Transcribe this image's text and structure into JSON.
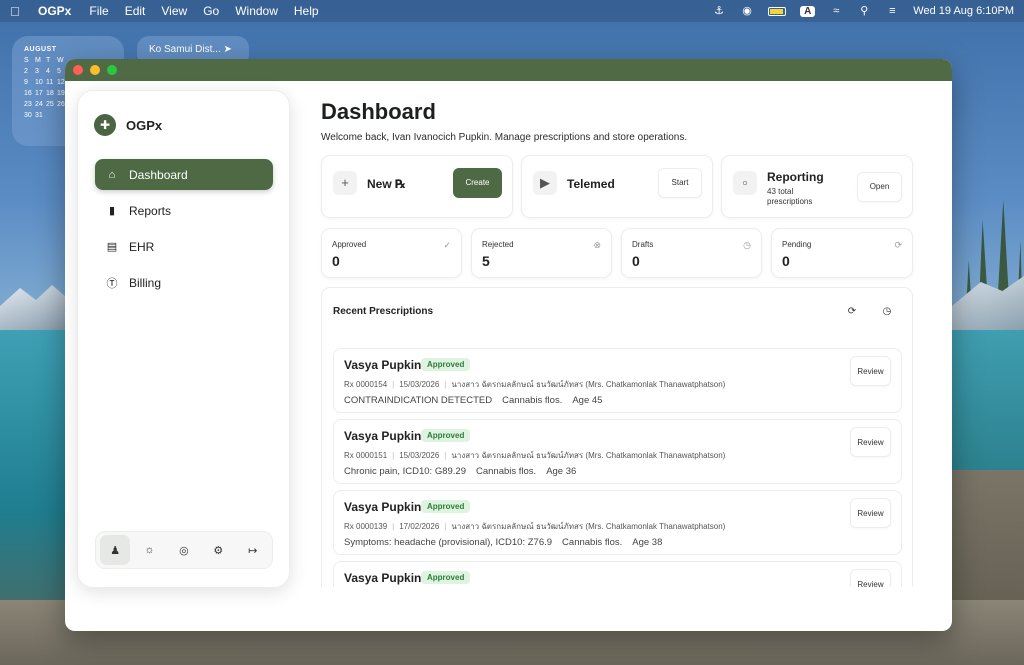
{
  "menubar": {
    "app": "OGPx",
    "menus": [
      "File",
      "Edit",
      "View",
      "Go",
      "Window",
      "Help"
    ],
    "clock": "Wed 19 Aug  6:10PM",
    "input_source": "A"
  },
  "widgets": {
    "calendar": {
      "month": "AUGUST",
      "weekdays": [
        "S",
        "M",
        "T",
        "W"
      ],
      "rows": [
        [
          "",
          "",
          "",
          ""
        ],
        [
          "2",
          "3",
          "4",
          "5"
        ],
        [
          "9",
          "10",
          "11",
          "12"
        ],
        [
          "16",
          "17",
          "18",
          "19"
        ],
        [
          "23",
          "24",
          "25",
          "26"
        ],
        [
          "30",
          "31",
          "",
          ""
        ]
      ]
    },
    "weather": {
      "location": "Ko Samui Dist..."
    }
  },
  "sidebar": {
    "brand": "OGPx",
    "items": [
      {
        "label": "Dashboard",
        "icon": "home-icon"
      },
      {
        "label": "Reports",
        "icon": "bar-chart-icon"
      },
      {
        "label": "EHR",
        "icon": "document-icon"
      },
      {
        "label": "Billing",
        "icon": "dollar-icon"
      }
    ],
    "tools": [
      "user-icon",
      "sun-icon",
      "globe-icon",
      "gear-icon",
      "logout-icon"
    ]
  },
  "main": {
    "title": "Dashboard",
    "subtitle": "Welcome back, Ivan Ivanocich Pupkin. Manage prescriptions and store operations.",
    "actions": {
      "new_rx": {
        "title": "New ℞",
        "button": "Create"
      },
      "telemed": {
        "title": "Telemed",
        "button": "Start"
      },
      "reporting": {
        "title": "Reporting",
        "line1": "43 total",
        "line2": "prescriptions",
        "button": "Open"
      }
    },
    "stats": [
      {
        "label": "Approved",
        "value": "0"
      },
      {
        "label": "Rejected",
        "value": "5"
      },
      {
        "label": "Drafts",
        "value": "0"
      },
      {
        "label": "Pending",
        "value": "0"
      }
    ],
    "recent": {
      "title": "Recent Prescriptions",
      "items": [
        {
          "name": "Vasya Pupkin",
          "status": "Approved",
          "rx": "Rx 0000154",
          "date": "15/03/2026",
          "doctor": "นางสาว ฉัตรกมลลักษณ์ ธนวัฒน์ภัทสร (Mrs. Chatkamonlak Thanawatphatson)",
          "notes": "CONTRAINDICATION DETECTED",
          "product": "Cannabis flos.",
          "age": "Age 45",
          "button": "Review"
        },
        {
          "name": "Vasya Pupkin",
          "status": "Approved",
          "rx": "Rx 0000151",
          "date": "15/03/2026",
          "doctor": "นางสาว ฉัตรกมลลักษณ์ ธนวัฒน์ภัทสร (Mrs. Chatkamonlak Thanawatphatson)",
          "notes": "Chronic pain, ICD10: G89.29",
          "product": "Cannabis flos.",
          "age": "Age 36",
          "button": "Review"
        },
        {
          "name": "Vasya Pupkin",
          "status": "Approved",
          "rx": "Rx 0000139",
          "date": "17/02/2026",
          "doctor": "นางสาว ฉัตรกมลลักษณ์ ธนวัฒน์ภัทสร (Mrs. Chatkamonlak Thanawatphatson)",
          "notes": "Symptoms: headache (provisional), ICD10: Z76.9",
          "product": "Cannabis flos.",
          "age": "Age 38",
          "button": "Review"
        },
        {
          "name": "Vasya Pupkin",
          "status": "Approved",
          "button": "Review"
        }
      ]
    }
  }
}
